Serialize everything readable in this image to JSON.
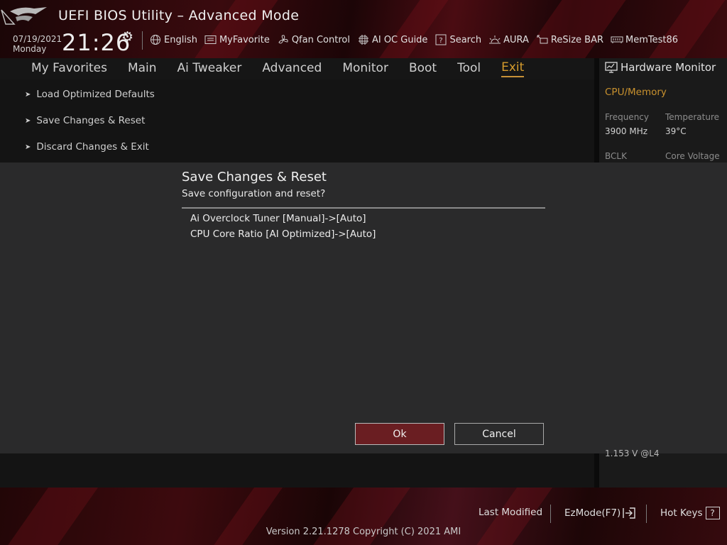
{
  "header": {
    "title": "UEFI BIOS Utility – Advanced Mode",
    "date": "07/19/2021",
    "weekday": "Monday",
    "time": "21:26",
    "toolbar": [
      {
        "label": "English",
        "icon": "globe-icon"
      },
      {
        "label": "MyFavorite",
        "icon": "favorite-icon"
      },
      {
        "label": "Qfan Control",
        "icon": "fan-icon"
      },
      {
        "label": "AI OC Guide",
        "icon": "ai-oc-guide-icon"
      },
      {
        "label": "Search",
        "icon": "search-help-icon"
      },
      {
        "label": "AURA",
        "icon": "aura-icon"
      },
      {
        "label": "ReSize BAR",
        "icon": "resize-bar-icon"
      },
      {
        "label": "MemTest86",
        "icon": "memtest-icon"
      }
    ]
  },
  "tabs": [
    {
      "label": "My Favorites"
    },
    {
      "label": "Main"
    },
    {
      "label": "Ai Tweaker"
    },
    {
      "label": "Advanced"
    },
    {
      "label": "Monitor"
    },
    {
      "label": "Boot"
    },
    {
      "label": "Tool"
    },
    {
      "label": "Exit",
      "active": true
    }
  ],
  "menu": [
    {
      "label": "Load Optimized Defaults"
    },
    {
      "label": "Save Changes & Reset"
    },
    {
      "label": "Discard Changes & Exit"
    }
  ],
  "hardware_monitor": {
    "title": "Hardware Monitor",
    "section": "CPU/Memory",
    "frequency_label": "Frequency",
    "frequency_value": "3900 MHz",
    "temperature_label": "Temperature",
    "temperature_value": "39°C",
    "bclk_label": "BCLK",
    "core_voltage_label": "Core Voltage",
    "partial_value": "1.153 V @L4"
  },
  "dialog": {
    "title": "Save Changes & Reset",
    "subtitle": "Save configuration and reset?",
    "changes": [
      "Ai Overclock Tuner [Manual]->[Auto]",
      "CPU Core Ratio [AI Optimized]->[Auto]"
    ],
    "ok_label": "Ok",
    "cancel_label": "Cancel"
  },
  "footer": {
    "last_modified": "Last Modified",
    "ezmode": "EzMode(F7)",
    "hotkeys": "Hot Keys",
    "hotkeys_key": "?",
    "version": "Version 2.21.1278 Copyright (C) 2021 AMI"
  },
  "colors": {
    "accent_gold": "#c8912e",
    "ok_button": "#6a1e22",
    "header_red": "#3a0a0e"
  }
}
